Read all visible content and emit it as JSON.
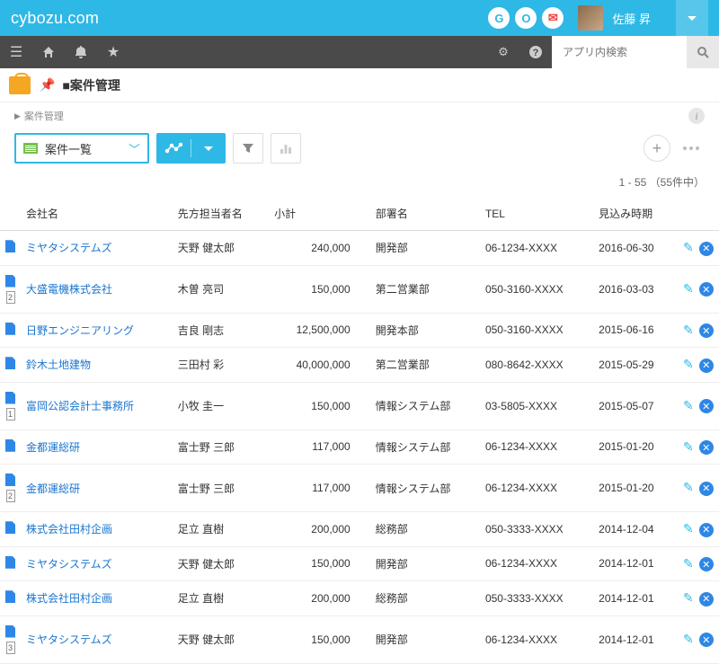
{
  "brand": "cybozu.com",
  "user_name": "佐藤 昇",
  "search_placeholder": "アプリ内検索",
  "app_title": "■案件管理",
  "breadcrumb": "案件管理",
  "view_label": "案件一覧",
  "paging_text": "1 - 55 （55件中）",
  "columns": {
    "company": "会社名",
    "contact": "先方担当者名",
    "subtotal": "小計",
    "dept": "部署名",
    "tel": "TEL",
    "forecast": "見込み時期"
  },
  "rows": [
    {
      "icon": "doc",
      "company": "ミヤタシステムズ",
      "contact": "天野 健太郎",
      "subtotal": "240,000",
      "dept": "開発部",
      "tel": "06-1234-XXXX",
      "forecast": "2016-06-30"
    },
    {
      "icon": "cnt",
      "count": "2",
      "company": "大盛電機株式会社",
      "contact": "木曽 亮司",
      "subtotal": "150,000",
      "dept": "第二営業部",
      "tel": "050-3160-XXXX",
      "forecast": "2016-03-03"
    },
    {
      "icon": "doc",
      "company": "日野エンジニアリング",
      "contact": "吉良 剛志",
      "subtotal": "12,500,000",
      "dept": "開発本部",
      "tel": "050-3160-XXXX",
      "forecast": "2015-06-16"
    },
    {
      "icon": "doc",
      "company": "鈴木土地建物",
      "contact": "三田村 彩",
      "subtotal": "40,000,000",
      "dept": "第二営業部",
      "tel": "080-8642-XXXX",
      "forecast": "2015-05-29"
    },
    {
      "icon": "cnt",
      "count": "1",
      "company": "富岡公認会計士事務所",
      "contact": "小牧 圭一",
      "subtotal": "150,000",
      "dept": "情報システム部",
      "tel": "03-5805-XXXX",
      "forecast": "2015-05-07"
    },
    {
      "icon": "doc",
      "company": "金都運総研",
      "contact": "富士野 三郎",
      "subtotal": "117,000",
      "dept": "情報システム部",
      "tel": "06-1234-XXXX",
      "forecast": "2015-01-20"
    },
    {
      "icon": "cnt",
      "count": "2",
      "company": "金都運総研",
      "contact": "富士野 三郎",
      "subtotal": "117,000",
      "dept": "情報システム部",
      "tel": "06-1234-XXXX",
      "forecast": "2015-01-20"
    },
    {
      "icon": "doc",
      "company": "株式会社田村企画",
      "contact": "足立 直樹",
      "subtotal": "200,000",
      "dept": "総務部",
      "tel": "050-3333-XXXX",
      "forecast": "2014-12-04"
    },
    {
      "icon": "doc",
      "company": "ミヤタシステムズ",
      "contact": "天野 健太郎",
      "subtotal": "150,000",
      "dept": "開発部",
      "tel": "06-1234-XXXX",
      "forecast": "2014-12-01"
    },
    {
      "icon": "doc",
      "company": "株式会社田村企画",
      "contact": "足立 直樹",
      "subtotal": "200,000",
      "dept": "総務部",
      "tel": "050-3333-XXXX",
      "forecast": "2014-12-01"
    },
    {
      "icon": "cnt",
      "count": "3",
      "company": "ミヤタシステムズ",
      "contact": "天野 健太郎",
      "subtotal": "150,000",
      "dept": "開発部",
      "tel": "06-1234-XXXX",
      "forecast": "2014-12-01"
    }
  ]
}
